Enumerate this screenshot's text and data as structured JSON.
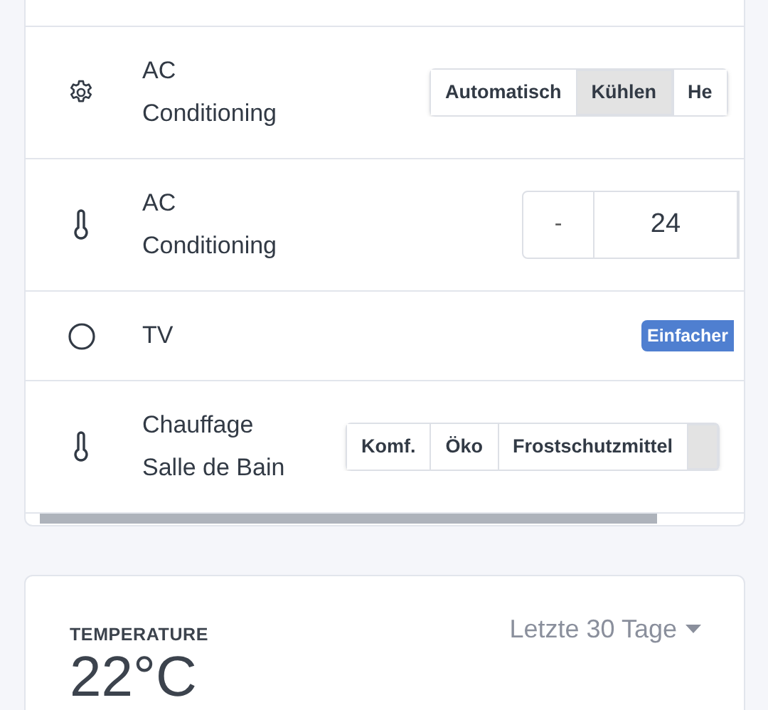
{
  "entities": [
    {
      "name": "AC Conditioning",
      "kind": "segmented",
      "options": [
        {
          "label": "Automatisch",
          "selected": false
        },
        {
          "label": "Kühlen",
          "selected": true
        },
        {
          "label": "He",
          "selected": false
        }
      ]
    },
    {
      "name": "AC Conditioning",
      "kind": "stepper",
      "minus": "-",
      "value": "24"
    },
    {
      "name": "TV",
      "kind": "badge",
      "badge": "Einfacher"
    },
    {
      "name": "Chauffage Salle de Bain",
      "kind": "segmented",
      "options": [
        {
          "label": "Komf.",
          "selected": false
        },
        {
          "label": "Öko",
          "selected": false
        },
        {
          "label": "Frostschutzmittel",
          "selected": false
        },
        {
          "selected": true
        }
      ]
    }
  ],
  "temperature_card": {
    "title": "TEMPERATURE",
    "range": "Letzte 30 Tage",
    "value": "22°C"
  }
}
